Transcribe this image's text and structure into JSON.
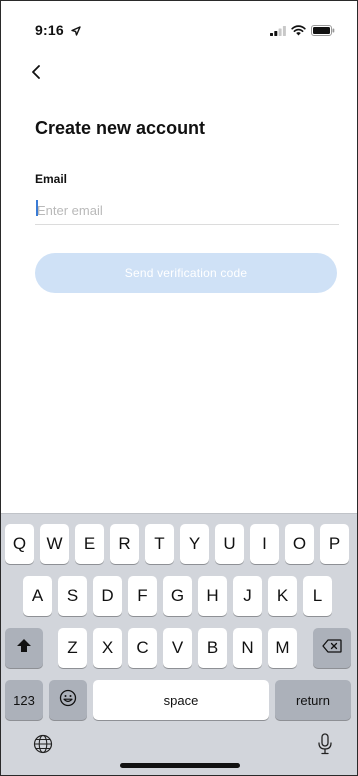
{
  "status_bar": {
    "time": "9:16",
    "icons": [
      "location-arrow-icon",
      "signal-icon",
      "wifi-icon",
      "battery-icon"
    ]
  },
  "header": {
    "back_icon": "chevron-left-icon",
    "title": "Create new account"
  },
  "form": {
    "email_label": "Email",
    "email_value": "",
    "email_placeholder": "Enter email",
    "send_button_label": "Send verification code"
  },
  "colors": {
    "button_disabled": "#cfe1f6",
    "caret": "#3a7bd5",
    "keyboard_bg": "#d2d5db",
    "key_bg": "#ffffff",
    "function_key_bg": "#acb1ba"
  },
  "keyboard": {
    "row1": [
      "Q",
      "W",
      "E",
      "R",
      "T",
      "Y",
      "U",
      "I",
      "O",
      "P"
    ],
    "row2": [
      "A",
      "S",
      "D",
      "F",
      "G",
      "H",
      "J",
      "K",
      "L"
    ],
    "row3": [
      "Z",
      "X",
      "C",
      "V",
      "B",
      "N",
      "M"
    ],
    "shift_icon": "shift-icon",
    "delete_icon": "backspace-icon",
    "numbers_label": "123",
    "emoji_icon": "emoji-icon",
    "space_label": "space",
    "return_label": "return",
    "globe_icon": "globe-icon",
    "mic_icon": "microphone-icon"
  }
}
